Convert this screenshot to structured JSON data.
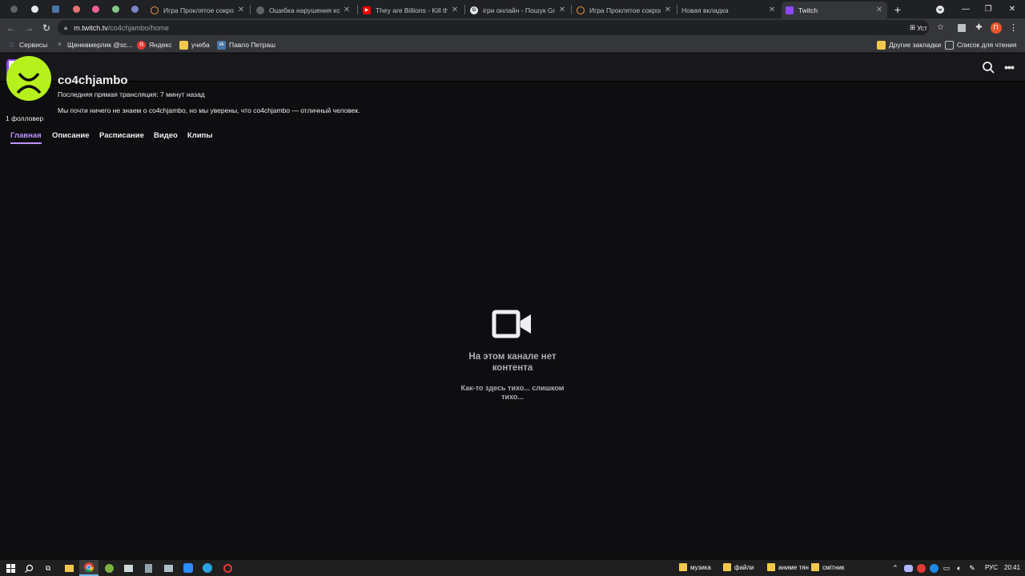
{
  "browser": {
    "tabs": [
      {
        "title": "Игра Проклятое сокров",
        "active": false
      },
      {
        "title": "Ошибка нарушения кон",
        "active": false
      },
      {
        "title": "They are Billions - Kill the",
        "active": false
      },
      {
        "title": "ігри онлайн - Пошук Go",
        "active": false
      },
      {
        "title": "Игра Проклятое сокров",
        "active": false
      },
      {
        "title": "Новая вкладка",
        "active": false
      },
      {
        "title": "Twitch",
        "active": true
      }
    ],
    "url_host": "m.twitch.tv",
    "url_path": "/co4chjambo/home",
    "install_label": "Уст",
    "profile_initial": "П",
    "bookmarks": [
      {
        "label": "Сервисы"
      },
      {
        "label": "Щеневмерлик @sc..."
      },
      {
        "label": "Яндекс"
      },
      {
        "label": "учеба"
      },
      {
        "label": "Павло Петраш"
      }
    ],
    "bookmarks_right": [
      {
        "label": "Другие закладки"
      },
      {
        "label": "Список для чтения"
      }
    ]
  },
  "channel": {
    "name": "co4chjambo",
    "last_stream": "Последняя прямая трансляция: 7 минут назад",
    "bio": "Мы почти ничего не знаем о co4chjambo, но мы уверены, что co4chjambo — отличный человек.",
    "followers": "1 фолловер",
    "tabs": [
      {
        "label": "Главная",
        "active": true
      },
      {
        "label": "Описание",
        "active": false
      },
      {
        "label": "Расписание",
        "active": false
      },
      {
        "label": "Видео",
        "active": false
      },
      {
        "label": "Клипы",
        "active": false
      }
    ]
  },
  "empty_state": {
    "title": "На этом канале нет контента",
    "subtitle": "Как-то здесь тихо... слишком тихо..."
  },
  "taskbar": {
    "folders": [
      {
        "label": "музика"
      },
      {
        "label": "файли"
      },
      {
        "label": "аниме тян"
      },
      {
        "label": "смітник"
      }
    ],
    "language": "РУС",
    "time": "20:41"
  },
  "colors": {
    "twitch_purple": "#9147ff",
    "active_tab_purple": "#bf94ff",
    "avatar_green": "#b6f01d",
    "page_bg": "#0e0e10"
  }
}
